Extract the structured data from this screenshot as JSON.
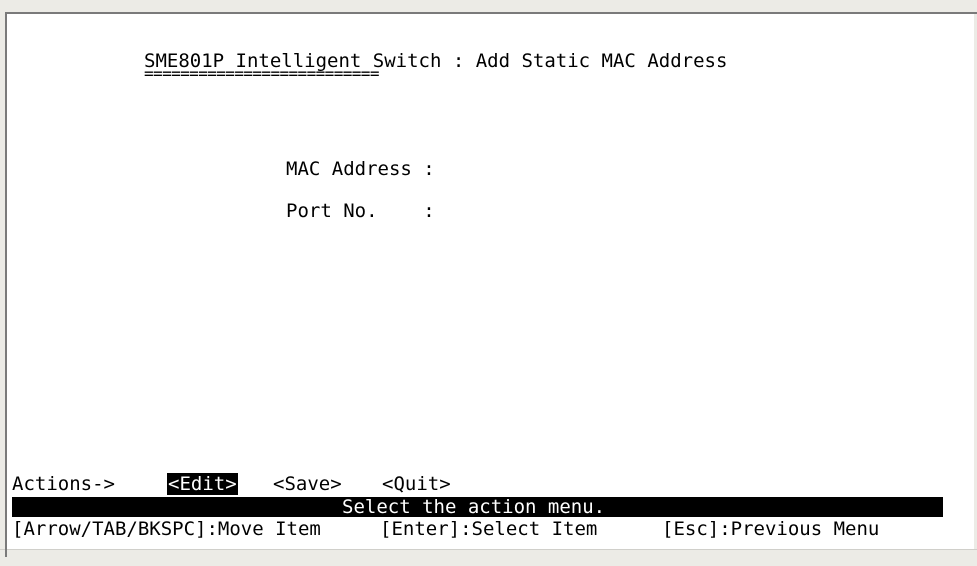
{
  "screen": {
    "title": "SME801P Intelligent Switch : Add Static MAC Address",
    "title_underline": "=========================="
  },
  "form": {
    "mac_address_label": "MAC Address :",
    "mac_address_value": "",
    "port_no_label": "Port No.    :",
    "port_no_value": ""
  },
  "actions": {
    "label": "Actions->",
    "items": [
      {
        "label": "<Edit>",
        "selected": true
      },
      {
        "label": "<Save>",
        "selected": false
      },
      {
        "label": "<Quit>",
        "selected": false
      }
    ]
  },
  "status": {
    "message": "Select the action menu."
  },
  "help": {
    "move": "[Arrow/TAB/BKSPC]:Move Item",
    "select": "[Enter]:Select Item",
    "back": "[Esc]:Previous Menu"
  },
  "colors": {
    "background": "#ffffff",
    "text": "#000000",
    "highlight_bg": "#000000",
    "highlight_fg": "#ffffff"
  }
}
